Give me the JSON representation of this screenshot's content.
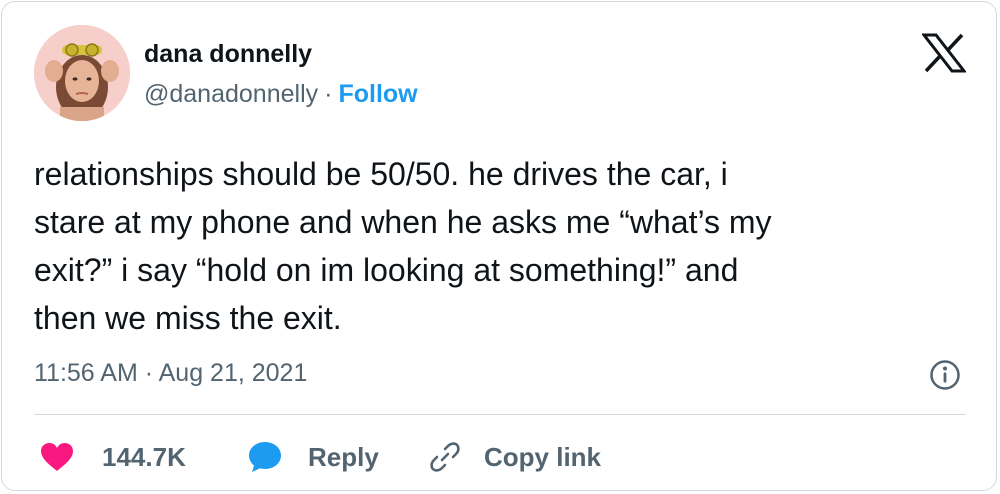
{
  "tweet": {
    "author_name": "dana donnelly",
    "handle": "@danadonnelly",
    "separator": "·",
    "follow_label": "Follow",
    "text": "relationships should be 50/50. he drives the car, i\nstare at my phone and when he asks me “what’s my\nexit?” i say “hold on im looking at something!” and\nthen we miss the exit.",
    "timestamp": "11:56 AM · Aug 21, 2021"
  },
  "actions": {
    "likes_count": "144.7K",
    "reply_label": "Reply",
    "copy_link_label": "Copy link"
  },
  "icons": {
    "logo": "x-logo-icon",
    "info": "info-icon",
    "like": "heart-icon",
    "reply": "speech-bubble-icon",
    "copy": "link-icon"
  },
  "colors": {
    "text": "#0f1419",
    "secondary": "#536471",
    "accent": "#1d9bf0",
    "like": "#f91880",
    "border": "#cfd9de"
  }
}
